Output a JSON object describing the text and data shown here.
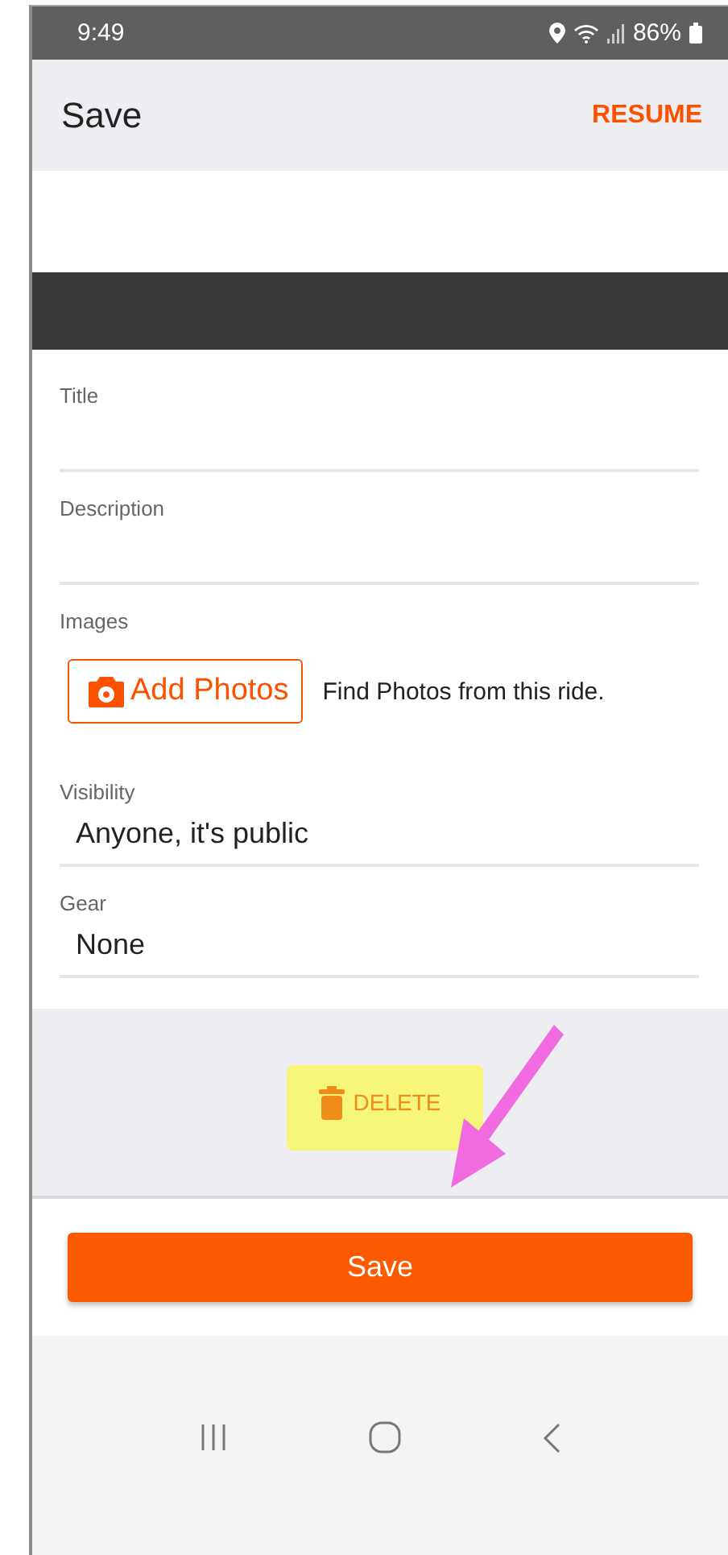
{
  "status_bar": {
    "time": "9:49",
    "battery": "86%"
  },
  "app_bar": {
    "title": "Save",
    "action": "RESUME"
  },
  "fields": [
    {
      "kind": "text",
      "label": "Title"
    },
    {
      "kind": "text",
      "label": "Description"
    },
    {
      "kind": "photos",
      "label": "Images",
      "button": "Add Photos",
      "hint": "Find Photos from this ride."
    },
    {
      "kind": "select",
      "label": "Visibility",
      "value": "Anyone, it's public"
    },
    {
      "kind": "select",
      "label": "Gear",
      "value": "None"
    }
  ],
  "delete_button": "DELETE",
  "save_button": "Save"
}
